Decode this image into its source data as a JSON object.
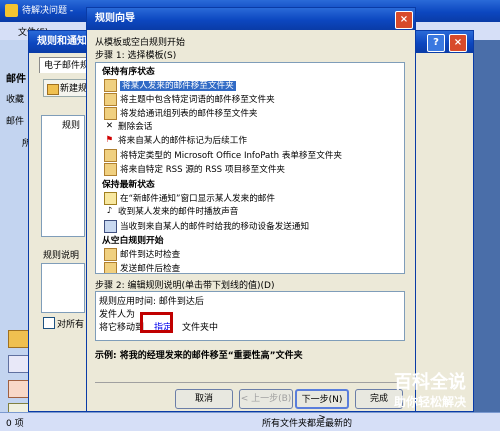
{
  "bg_window": {
    "title": "待解决问题 -",
    "menu_item": "文件(F)"
  },
  "mid_window": {
    "title": "规则和通知",
    "tab": "电子邮件规则",
    "new_button": "新建规",
    "col_header": "规则",
    "desc_label": "规则说明",
    "checkbox_label": "对所有"
  },
  "left_nav": {
    "items": [
      "邮件",
      "收藏",
      "邮件",
      "所"
    ]
  },
  "status_bar": {
    "left": "0 项",
    "right": "所有文件夹都是最新的"
  },
  "dialog": {
    "title": "规则向导",
    "intro": "从模板或空白规则开始",
    "step1": "步骤 1: 选择模板(S)",
    "groups": [
      {
        "header": "保持有序状态",
        "items": [
          {
            "icon": "envelope-move-icon",
            "label": "将某人发来的邮件移至文件夹",
            "selected": true
          },
          {
            "icon": "envelope-move-icon",
            "label": "将主题中包含特定词语的邮件移至文件夹"
          },
          {
            "icon": "envelope-move-icon",
            "label": "将发给通讯组列表的邮件移至文件夹"
          },
          {
            "icon": "delete-x-icon",
            "label": "删除会话"
          },
          {
            "icon": "flag-icon",
            "label": "将来自某人的邮件标记为后续工作"
          },
          {
            "icon": "envelope-move-icon",
            "label": "将特定类型的 Microsoft Office InfoPath 表单移至文件夹"
          },
          {
            "icon": "envelope-move-icon",
            "label": "将来自特定 RSS 源的 RSS 项目移至文件夹"
          }
        ]
      },
      {
        "header": "保持最新状态",
        "items": [
          {
            "icon": "alert-window-icon",
            "label": "在“新邮件通知”窗口显示某人发来的邮件"
          },
          {
            "icon": "sound-icon",
            "label": "收到某人发来的邮件时播放声音"
          },
          {
            "icon": "mobile-device-icon",
            "label": "当收到来自某人的邮件时给我的移动设备发送通知"
          }
        ]
      },
      {
        "header": "从空白规则开始",
        "items": [
          {
            "icon": "envelope-check-icon",
            "label": "邮件到达时检查"
          },
          {
            "icon": "envelope-check-icon",
            "label": "发送邮件后检查"
          }
        ]
      }
    ],
    "step2": "步骤 2: 编辑规则说明(单击带下划线的值)(D)",
    "desc_lines": [
      "规则应用时间: 邮件到达后",
      "发件人为",
      "将它移动到",
      "指定",
      "文件夹中"
    ],
    "example": "示例: 将我的经理发来的邮件移至“重要性高”文件夹",
    "buttons": {
      "cancel": "取消",
      "back": "< 上一步(B)",
      "next": "下一步(N) >",
      "finish": "完成"
    }
  },
  "watermark": {
    "line1": "百科全说",
    "line2": "助你轻松解决"
  },
  "colors": {
    "xp_blue": "#0c47c0",
    "highlight": "#316ac5",
    "red_box": "#c00000"
  }
}
